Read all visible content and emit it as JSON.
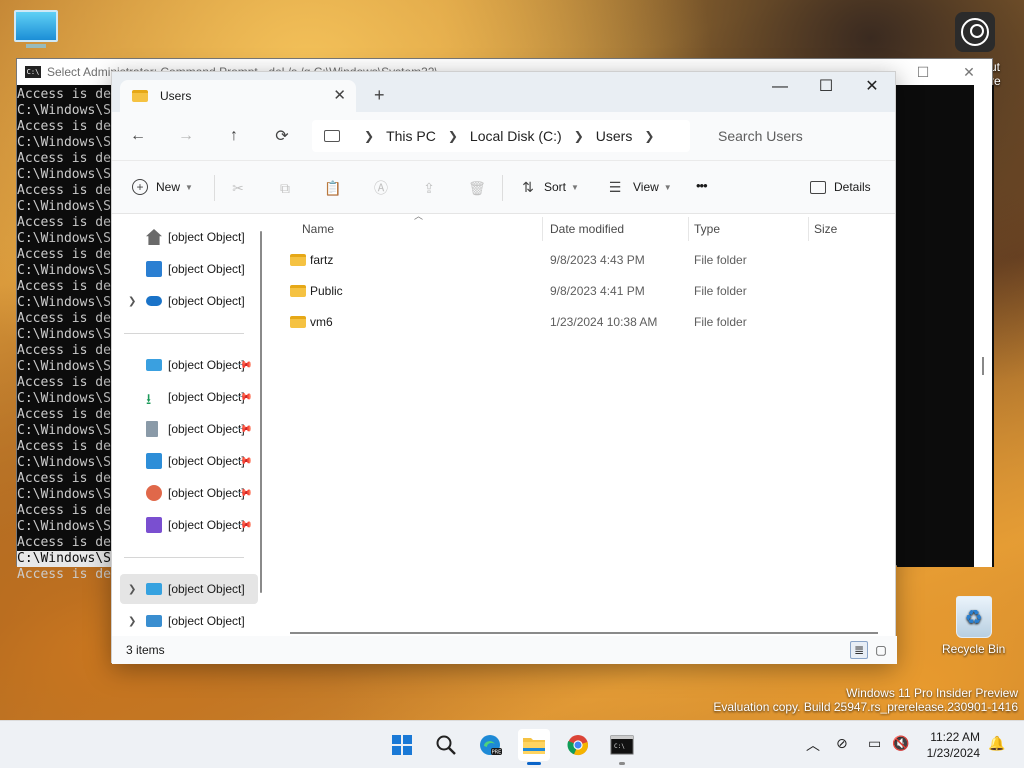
{
  "desktop": {
    "icons": [
      {
        "label": ""
      },
      {
        "label": "Recycle Bin"
      }
    ],
    "edge_text": [
      "ut",
      "re"
    ],
    "watermark": {
      "line1": "Windows 11 Pro Insider Preview",
      "line2": "Evaluation copy. Build 25947.rs_prerelease.230901-1416"
    }
  },
  "cmd": {
    "title": "Select Administrator: Command Prompt - del  /s /q C:\\Windows\\System32\\",
    "controls": {
      "minimize": "—",
      "maximize": "☐",
      "close": "✕"
    },
    "lines": [
      "Access is de",
      "C:\\Windows\\S",
      "Access is de",
      "C:\\Windows\\S",
      "Access is de",
      "C:\\Windows\\S",
      "Access is de",
      "C:\\Windows\\S",
      "Access is de",
      "C:\\Windows\\S",
      "Access is de",
      "C:\\Windows\\S",
      "Access is de",
      "C:\\Windows\\S",
      "Access is de",
      "C:\\Windows\\S",
      "Access is de",
      "C:\\Windows\\S",
      "Access is de",
      "C:\\Windows\\S",
      "Access is de",
      "C:\\Windows\\S",
      "Access is de",
      "C:\\Windows\\S",
      "Access is de",
      "C:\\Windows\\S",
      "Access is de",
      "C:\\Windows\\S",
      "Access is de",
      "C:\\Windows\\S",
      "Access is de"
    ],
    "selected_line_index": 29
  },
  "explorer": {
    "tab": {
      "title": "Users",
      "close": "✕"
    },
    "new_tab": "+",
    "window_controls": {
      "minimize": "—",
      "maximize": "☐",
      "close": "✕"
    },
    "nav": {
      "back": "←",
      "forward": "→",
      "up": "↑",
      "refresh": "⟳"
    },
    "breadcrumb": [
      "This PC",
      "Local Disk (C:)",
      "Users"
    ],
    "search_placeholder": "Search Users",
    "commands": {
      "new": "New",
      "sort": "Sort",
      "view": "View",
      "more": "•••",
      "details": "Details"
    },
    "nav_pane": {
      "top": [
        {
          "label": "Home",
          "icon": "home-icon"
        },
        {
          "label": "Gallery",
          "icon": "gallery-icon"
        },
        {
          "label": "OneDrive",
          "icon": "cloud-icon"
        }
      ],
      "quick": [
        {
          "label": "Desktop",
          "icon": "desktop-icon"
        },
        {
          "label": "Downloads",
          "icon": "download-icon"
        },
        {
          "label": "Documents",
          "icon": "document-icon"
        },
        {
          "label": "Pictures",
          "icon": "picture-icon"
        },
        {
          "label": "Music",
          "icon": "music-icon"
        },
        {
          "label": "Videos",
          "icon": "video-icon"
        }
      ],
      "bottom": [
        {
          "label": "This PC",
          "icon": "computer-icon"
        },
        {
          "label": "Network",
          "icon": "network-icon"
        }
      ]
    },
    "columns": [
      "Name",
      "Date modified",
      "Type",
      "Size"
    ],
    "files": [
      {
        "name": "fartz",
        "date": "9/8/2023 4:43 PM",
        "type": "File folder"
      },
      {
        "name": "Public",
        "date": "9/8/2023 4:41 PM",
        "type": "File folder"
      },
      {
        "name": "vm6",
        "date": "1/23/2024 10:38 AM",
        "type": "File folder"
      }
    ],
    "status": "3 items"
  },
  "taskbar": {
    "pinned": [
      "start-icon",
      "search-icon",
      "edge-icon",
      "file-explorer-icon",
      "chrome-icon",
      "terminal-icon"
    ],
    "time": "11:22 AM",
    "date": "1/23/2024"
  }
}
